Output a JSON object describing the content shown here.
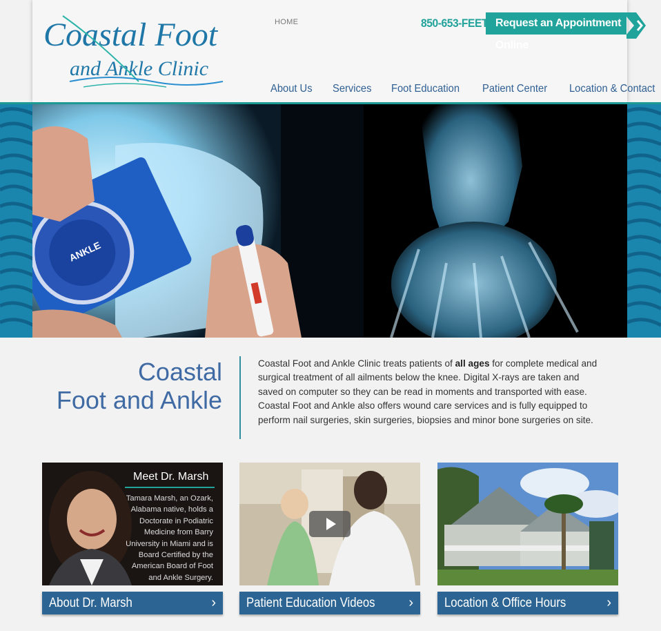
{
  "header": {
    "logo_line1": "Coastal Foot",
    "logo_line2": "and Ankle Clinic",
    "home_link": "HOME",
    "phone": "850-653-FEET",
    "appointment_button": "Request an Appointment Online"
  },
  "nav": {
    "items": [
      {
        "label": "About Us"
      },
      {
        "label": "Services"
      },
      {
        "label": "Foot Education"
      },
      {
        "label": "Patient Center"
      },
      {
        "label": "Location & Contact"
      }
    ]
  },
  "hero": {
    "icon": "xray-image"
  },
  "intro": {
    "title_line1": "Coastal",
    "title_line2": "Foot and Ankle",
    "text_before": "Coastal Foot and Ankle Clinic treats patients of ",
    "text_bold": "all ages",
    "text_after": " for complete medical and surgical treatment of all ailments below the knee. Digital X-rays are taken and saved on computer so they can be read in moments and transported with ease. Coastal Foot and Ankle also offers wound care services and is fully equipped to perform nail surgeries, skin surgeries, biopsies and minor bone surgeries on site."
  },
  "cards": [
    {
      "overlay_title": "Meet Dr. Marsh",
      "overlay_text": "Tamara Marsh, an Ozark, Alabama native, holds a Doctorate in Podiatric Medicine from Barry University in Miami and is Board Certified by the American Board of Foot and Ankle Surgery.",
      "button": "About Dr. Marsh"
    },
    {
      "button": "Patient Education Videos"
    },
    {
      "button": "Location & Office Hours"
    }
  ],
  "colors": {
    "teal": "#1fa39b",
    "nav_blue": "#2f5f93",
    "button_blue": "#2c6593",
    "title_blue": "#3f6aa3"
  }
}
